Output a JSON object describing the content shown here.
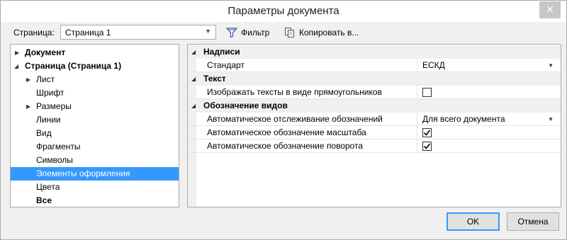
{
  "window": {
    "title": "Параметры документа",
    "close_glyph": "✕"
  },
  "toolbar": {
    "page_label": "Страница:",
    "page_value": "Страница 1",
    "filter_label": "Фильтр",
    "copy_label": "Копировать в..."
  },
  "tree": {
    "items": [
      {
        "label": "Документ"
      },
      {
        "label": "Страница (Страница 1)"
      },
      {
        "label": "Лист"
      },
      {
        "label": "Шрифт"
      },
      {
        "label": "Размеры"
      },
      {
        "label": "Линии"
      },
      {
        "label": "Вид"
      },
      {
        "label": "Фрагменты"
      },
      {
        "label": "Символы"
      },
      {
        "label": "Элементы оформления"
      },
      {
        "label": "Цвета"
      },
      {
        "label": "Все"
      }
    ],
    "selected": "Элементы оформления"
  },
  "properties": {
    "cat_inscriptions": "Надписи",
    "standard_name": "Стандарт",
    "standard_value": "ЕСКД",
    "cat_text": "Текст",
    "text_rect_name": "Изображать тексты в виде прямоугольников",
    "text_rect_checked": false,
    "cat_view_designation": "Обозначение видов",
    "auto_track_name": "Автоматическое отслеживание обозначений",
    "auto_track_value": "Для всего документа",
    "auto_scale_name": "Автоматическое обозначение масштаба",
    "auto_scale_checked": true,
    "auto_rotate_name": "Автоматическое обозначение поворота",
    "auto_rotate_checked": true
  },
  "buttons": {
    "ok": "OK",
    "cancel": "Отмена"
  },
  "colors": {
    "selection": "#3399ff",
    "default_button_border": "#3399ff",
    "close_button": "#c7c7c7"
  }
}
